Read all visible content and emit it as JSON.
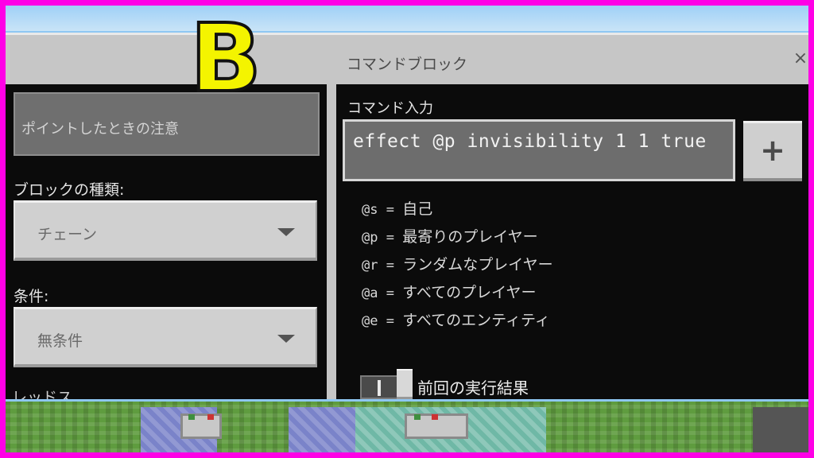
{
  "overlay": {
    "letter": "B"
  },
  "window": {
    "title": "コマンドブロック",
    "close": "×"
  },
  "left": {
    "tooltip_placeholder": "ポイントしたときの注意",
    "block_type_label": "ブロックの種類:",
    "block_type_value": "チェーン",
    "condition_label": "条件:",
    "condition_value": "無条件",
    "next_label_partial": "レッドストーン"
  },
  "right": {
    "command_label": "コマンド入力",
    "command_value": "effect @p invisibility 1 1 true",
    "plus_label": "+",
    "selectors": [
      {
        "code": "@s",
        "eq": " = ",
        "desc": "自己"
      },
      {
        "code": "@p",
        "eq": " = ",
        "desc": "最寄りのプレイヤー"
      },
      {
        "code": "@r",
        "eq": " = ",
        "desc": "ランダムなプレイヤー"
      },
      {
        "code": "@a",
        "eq": " = ",
        "desc": "すべてのプレイヤー"
      },
      {
        "code": "@e",
        "eq": " = ",
        "desc": "すべてのエンティティ"
      }
    ],
    "previous_output_label": "前回の実行結果",
    "previous_output_toggle": false
  },
  "colors": {
    "border": "#ff00e6",
    "letter": "#f4f400",
    "panel": "#0b0b0b",
    "window": "#c6c6c6"
  }
}
